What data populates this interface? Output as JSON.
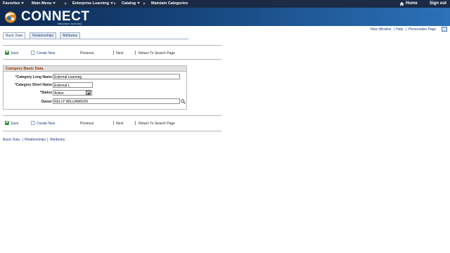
{
  "topnav": {
    "items": [
      {
        "label": "Favorites",
        "has_menu": true
      },
      {
        "label": "Main Menu",
        "has_menu": true
      },
      {
        "label": "Enterprise Learning",
        "has_menu": true
      },
      {
        "label": "Catalog",
        "has_menu": true
      },
      {
        "label": "Maintain Categories",
        "has_menu": false
      }
    ],
    "home_label": "Home",
    "signout_label": "Sign out"
  },
  "banner": {
    "logo_text": "CONNECT",
    "logo_sub": "Maryland Judiciary"
  },
  "utility_links": {
    "new_window": "New Window",
    "help": "Help",
    "personalize": "Personalize Page",
    "separator": "|"
  },
  "tabs": [
    {
      "label": "Basic Data",
      "active": true
    },
    {
      "label": "Relationships",
      "active": false
    },
    {
      "label": "Attributes",
      "active": false
    }
  ],
  "toolbar": {
    "save": "Save",
    "create_new": "Create New",
    "previous": "Previous",
    "next": "Next",
    "return_search": "Return To Search Page"
  },
  "category_box": {
    "title": "Category Basic Data",
    "long_name_label": "*Category Long Name",
    "long_name_value": "External Learning",
    "short_name_label": "*Category Short Name",
    "short_name_value": "External L",
    "status_label": "*Status",
    "status_value": "Active",
    "owner_label": "Owner",
    "owner_value": "KELLY WILLIAMSON"
  },
  "bottom_links": {
    "basic_data": "Basic Data",
    "relationships": "Relationships",
    "attributes": "Attributes",
    "separator": "|"
  },
  "colors": {
    "nav_bg": "#1b2b45",
    "banner_start": "#0e2a52",
    "banner_end": "#2b72b8",
    "link": "#1f3f80",
    "group_title": "#9a3800",
    "save_icon": "#2e8b2e"
  },
  "icons": [
    "home-icon",
    "connect-logo-icon",
    "personalize-icon",
    "save-icon",
    "create-new-icon",
    "lookup-magnifier-icon",
    "dropdown-arrow-icon"
  ]
}
